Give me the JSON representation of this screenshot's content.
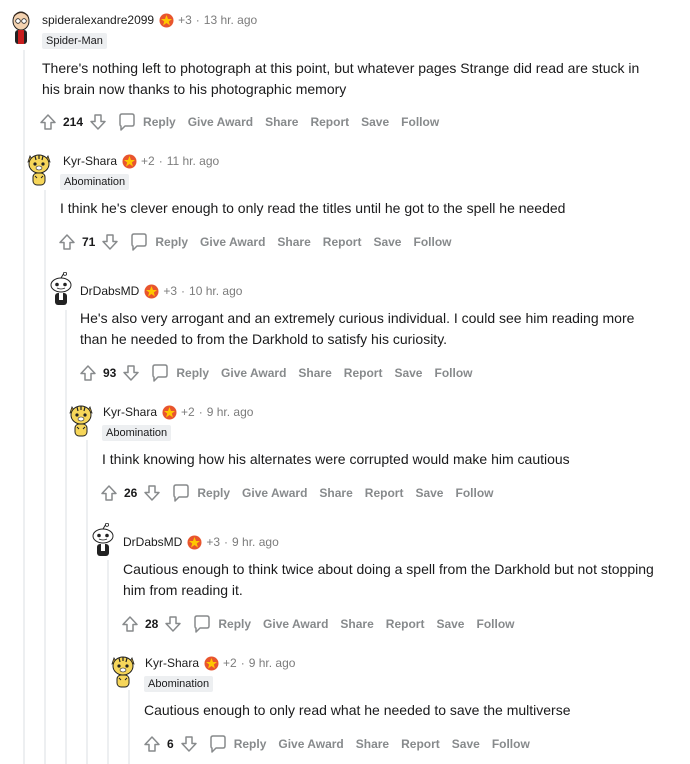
{
  "action_labels": {
    "reply": "Reply",
    "give_award": "Give Award",
    "share": "Share",
    "report": "Report",
    "save": "Save",
    "follow": "Follow"
  },
  "colors": {
    "award_outer": "#e8552d",
    "award_inner": "#ffc700",
    "thread_line": "#edeff1",
    "flair_bg": "#edeff1",
    "muted": "#878a8c"
  },
  "comments": [
    {
      "username": "spideralexandre2099",
      "karma": "+3",
      "time": "13 hr. ago",
      "flair": "Spider-Man",
      "body": "There's nothing left to photograph at this point, but whatever pages Strange did read are stuck in his brain now thanks to his photographic memory",
      "score": "214",
      "avatar_icon": "spider-man-avatar-icon"
    },
    {
      "username": "Kyr-Shara",
      "karma": "+2",
      "time": "11 hr. ago",
      "flair": "Abomination",
      "body": "I think he's clever enough to only read the titles until he got to the spell he needed",
      "score": "71",
      "avatar_icon": "tiger-avatar-icon"
    },
    {
      "username": "DrDabsMD",
      "karma": "+3",
      "time": "10 hr. ago",
      "flair": "",
      "body": "He's also very arrogant and an extremely curious individual. I could see him reading more than he needed to from the Darkhold to satisfy his curiosity.",
      "score": "93",
      "avatar_icon": "snoo-avatar-icon"
    },
    {
      "username": "Kyr-Shara",
      "karma": "+2",
      "time": "9 hr. ago",
      "flair": "Abomination",
      "body": "I think knowing how his alternates were corrupted would make him cautious",
      "score": "26",
      "avatar_icon": "tiger-avatar-icon"
    },
    {
      "username": "DrDabsMD",
      "karma": "+3",
      "time": "9 hr. ago",
      "flair": "",
      "body": "Cautious enough to think twice about doing a spell from the Darkhold but not stopping him from reading it.",
      "score": "28",
      "avatar_icon": "snoo-avatar-icon"
    },
    {
      "username": "Kyr-Shara",
      "karma": "+2",
      "time": "9 hr. ago",
      "flair": "Abomination",
      "body": "Cautious enough to only read what he needed to save the multiverse",
      "score": "6",
      "avatar_icon": "tiger-avatar-icon"
    }
  ]
}
